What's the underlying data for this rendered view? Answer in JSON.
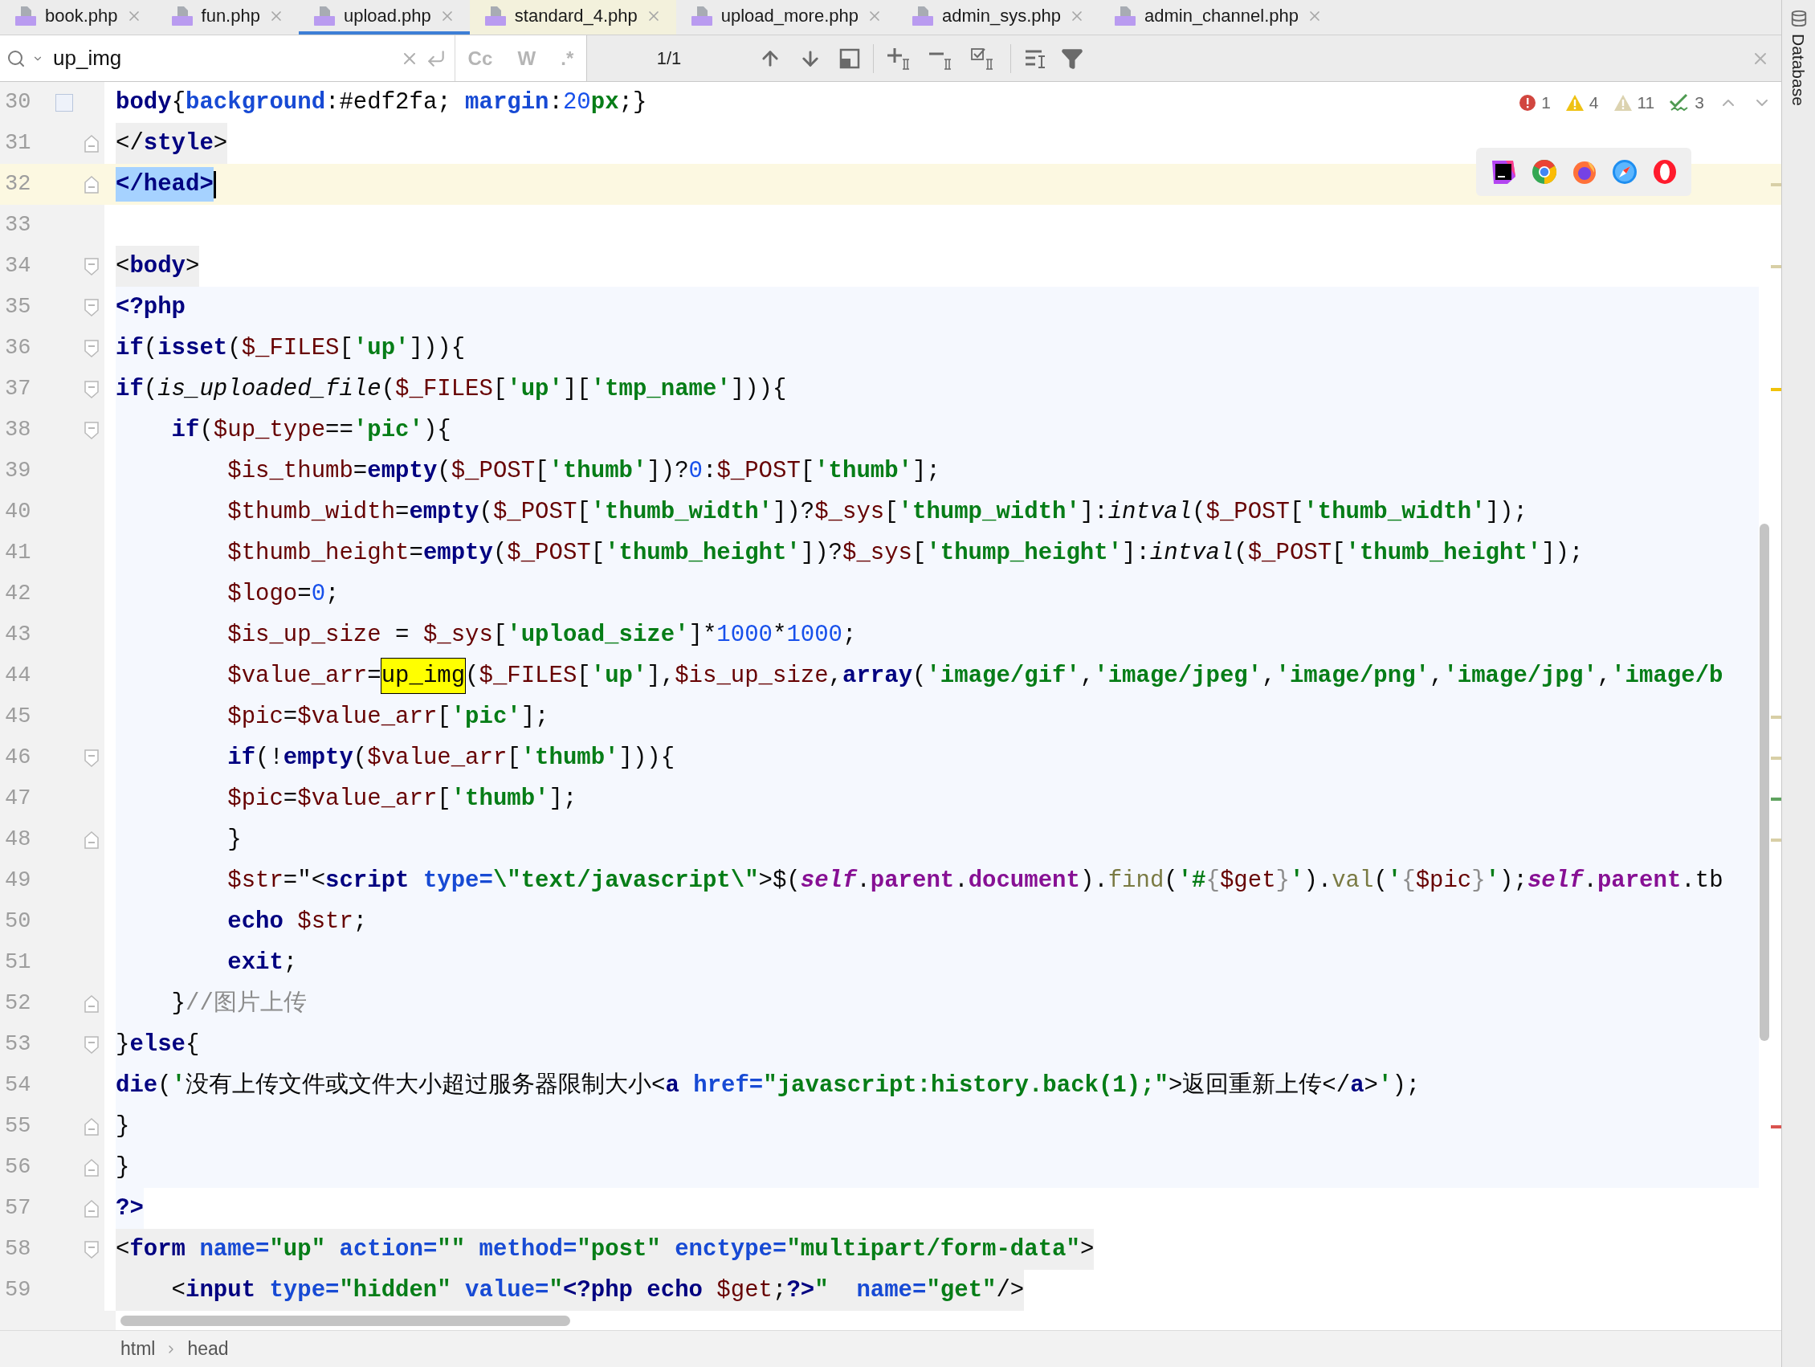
{
  "tabs": [
    {
      "label": "book.php",
      "selected": false,
      "highlighted": false
    },
    {
      "label": "fun.php",
      "selected": false,
      "highlighted": false
    },
    {
      "label": "upload.php",
      "selected": true,
      "highlighted": false
    },
    {
      "label": "standard_4.php",
      "selected": false,
      "highlighted": true
    },
    {
      "label": "upload_more.php",
      "selected": false,
      "highlighted": false
    },
    {
      "label": "admin_sys.php",
      "selected": false,
      "highlighted": false
    },
    {
      "label": "admin_channel.php",
      "selected": false,
      "highlighted": false
    }
  ],
  "search": {
    "value": "up_img",
    "toggles": [
      {
        "label": "Cc",
        "on": false
      },
      {
        "label": "W",
        "on": false
      },
      {
        "label": ".*",
        "on": false
      }
    ],
    "result_count": "1/1"
  },
  "inspections": [
    {
      "kind": "error",
      "count": "1"
    },
    {
      "kind": "warning",
      "count": "4"
    },
    {
      "kind": "weak_warning",
      "count": "11"
    },
    {
      "kind": "typo",
      "count": "3"
    }
  ],
  "lines": [
    {
      "number": "30",
      "current": false,
      "kind": "plain",
      "fold_start": false,
      "fold_end": false,
      "marked": true,
      "tokens": [
        {
          "text": "body",
          "kind": "tag"
        },
        {
          "text": "{",
          "kind": "p"
        },
        {
          "text": "background",
          "kind": "attr"
        },
        {
          "text": ":#edf2fa; ",
          "kind": "p"
        },
        {
          "text": "margin",
          "kind": "attr"
        },
        {
          "text": ":",
          "kind": "p"
        },
        {
          "text": "20",
          "kind": "num"
        },
        {
          "text": "px",
          "kind": "str"
        },
        {
          "text": ";}",
          "kind": "p"
        }
      ]
    },
    {
      "number": "31",
      "current": false,
      "kind": "html-tag",
      "fold_start": false,
      "fold_end": true,
      "marked": false,
      "tokens": [
        {
          "text": "</",
          "kind": "p"
        },
        {
          "text": "style",
          "kind": "tag"
        },
        {
          "text": ">",
          "kind": "p"
        }
      ]
    },
    {
      "number": "32",
      "current": true,
      "kind": "plain",
      "fold_start": false,
      "fold_end": true,
      "marked": false,
      "color": "#d8cfa6",
      "tokens": [
        {
          "text": "</head>",
          "kind": "sel"
        }
      ]
    },
    {
      "number": "33",
      "current": false,
      "kind": "plain",
      "fold_start": false,
      "fold_end": false,
      "marked": false
    },
    {
      "number": "34",
      "current": false,
      "kind": "html-tag",
      "fold_start": true,
      "fold_end": false,
      "marked": false,
      "color": "#d8cfa6",
      "tokens": [
        {
          "text": "<",
          "kind": "p"
        },
        {
          "text": "body",
          "kind": "tag"
        },
        {
          "text": ">",
          "kind": "p"
        }
      ]
    },
    {
      "number": "35",
      "current": false,
      "kind": "php",
      "fold_start": true,
      "fold_end": false,
      "marked": false,
      "tokens": [
        {
          "text": "<?php",
          "kind": "kw"
        }
      ]
    },
    {
      "number": "36",
      "current": false,
      "kind": "php",
      "fold_start": true,
      "fold_end": false,
      "marked": false,
      "tokens": [
        {
          "text": "if",
          "kind": "kw"
        },
        {
          "text": "(",
          "kind": "p"
        },
        {
          "text": "isset",
          "kind": "kw"
        },
        {
          "text": "(",
          "kind": "p"
        },
        {
          "text": "$_FILES",
          "kind": "var"
        },
        {
          "text": "[",
          "kind": "p"
        },
        {
          "text": "'up'",
          "kind": "str"
        },
        {
          "text": "])){",
          "kind": "p"
        }
      ]
    },
    {
      "number": "37",
      "current": false,
      "kind": "php",
      "fold_start": true,
      "fold_end": false,
      "marked": false,
      "color": "#f0c20a",
      "tokens": [
        {
          "text": "if",
          "kind": "kw"
        },
        {
          "text": "(",
          "kind": "p"
        },
        {
          "text": "is_uploaded_file",
          "kind": "it"
        },
        {
          "text": "(",
          "kind": "p"
        },
        {
          "text": "$_FILES",
          "kind": "var"
        },
        {
          "text": "[",
          "kind": "p"
        },
        {
          "text": "'up'",
          "kind": "str"
        },
        {
          "text": "][",
          "kind": "p"
        },
        {
          "text": "'tmp_name'",
          "kind": "str"
        },
        {
          "text": "])){",
          "kind": "p"
        }
      ]
    },
    {
      "number": "38",
      "current": false,
      "kind": "php",
      "fold_start": true,
      "fold_end": false,
      "marked": false,
      "tokens": [
        {
          "text": "    if",
          "kind": "kw"
        },
        {
          "text": "(",
          "kind": "p"
        },
        {
          "text": "$up_type",
          "kind": "var"
        },
        {
          "text": "==",
          "kind": "p"
        },
        {
          "text": "'pic'",
          "kind": "str"
        },
        {
          "text": "){",
          "kind": "p"
        }
      ]
    },
    {
      "number": "39",
      "current": false,
      "kind": "php",
      "fold_start": false,
      "fold_end": false,
      "marked": false,
      "tokens": [
        {
          "text": "        $is_thumb",
          "kind": "var"
        },
        {
          "text": "=",
          "kind": "p"
        },
        {
          "text": "empty",
          "kind": "kw"
        },
        {
          "text": "(",
          "kind": "p"
        },
        {
          "text": "$_POST",
          "kind": "var"
        },
        {
          "text": "[",
          "kind": "p"
        },
        {
          "text": "'thumb'",
          "kind": "str"
        },
        {
          "text": "])?",
          "kind": "p"
        },
        {
          "text": "0",
          "kind": "num"
        },
        {
          "text": ":",
          "kind": "p"
        },
        {
          "text": "$_POST",
          "kind": "var"
        },
        {
          "text": "[",
          "kind": "p"
        },
        {
          "text": "'thumb'",
          "kind": "str"
        },
        {
          "text": "];",
          "kind": "p"
        }
      ]
    },
    {
      "number": "40",
      "current": false,
      "kind": "php",
      "fold_start": false,
      "fold_end": false,
      "marked": false,
      "tokens": [
        {
          "text": "        $thumb_width",
          "kind": "var"
        },
        {
          "text": "=",
          "kind": "p"
        },
        {
          "text": "empty",
          "kind": "kw"
        },
        {
          "text": "(",
          "kind": "p"
        },
        {
          "text": "$_POST",
          "kind": "var"
        },
        {
          "text": "[",
          "kind": "p"
        },
        {
          "text": "'thumb_width'",
          "kind": "str"
        },
        {
          "text": "])?",
          "kind": "p"
        },
        {
          "text": "$_sys",
          "kind": "var"
        },
        {
          "text": "[",
          "kind": "p"
        },
        {
          "text": "'thump_width'",
          "kind": "str"
        },
        {
          "text": "]:",
          "kind": "p"
        },
        {
          "text": "intval",
          "kind": "it"
        },
        {
          "text": "(",
          "kind": "p"
        },
        {
          "text": "$_POST",
          "kind": "var"
        },
        {
          "text": "[",
          "kind": "p"
        },
        {
          "text": "'thumb_width'",
          "kind": "str"
        },
        {
          "text": "]);",
          "kind": "p"
        }
      ]
    },
    {
      "number": "41",
      "current": false,
      "kind": "php",
      "fold_start": false,
      "fold_end": false,
      "marked": false,
      "tokens": [
        {
          "text": "        $thumb_height",
          "kind": "var"
        },
        {
          "text": "=",
          "kind": "p"
        },
        {
          "text": "empty",
          "kind": "kw"
        },
        {
          "text": "(",
          "kind": "p"
        },
        {
          "text": "$_POST",
          "kind": "var"
        },
        {
          "text": "[",
          "kind": "p"
        },
        {
          "text": "'thumb_height'",
          "kind": "str"
        },
        {
          "text": "])?",
          "kind": "p"
        },
        {
          "text": "$_sys",
          "kind": "var"
        },
        {
          "text": "[",
          "kind": "p"
        },
        {
          "text": "'thump_height'",
          "kind": "str"
        },
        {
          "text": "]:",
          "kind": "p"
        },
        {
          "text": "intval",
          "kind": "it"
        },
        {
          "text": "(",
          "kind": "p"
        },
        {
          "text": "$_POST",
          "kind": "var"
        },
        {
          "text": "[",
          "kind": "p"
        },
        {
          "text": "'thumb_height'",
          "kind": "str"
        },
        {
          "text": "]);",
          "kind": "p"
        }
      ]
    },
    {
      "number": "42",
      "current": false,
      "kind": "php",
      "fold_start": false,
      "fold_end": false,
      "marked": false,
      "tokens": [
        {
          "text": "        $logo",
          "kind": "var"
        },
        {
          "text": "=",
          "kind": "p"
        },
        {
          "text": "0",
          "kind": "num"
        },
        {
          "text": ";",
          "kind": "p"
        }
      ]
    },
    {
      "number": "43",
      "current": false,
      "kind": "php",
      "fold_start": false,
      "fold_end": false,
      "marked": false,
      "tokens": [
        {
          "text": "        $is_up_size",
          "kind": "var"
        },
        {
          "text": " = ",
          "kind": "p"
        },
        {
          "text": "$_sys",
          "kind": "var"
        },
        {
          "text": "[",
          "kind": "p"
        },
        {
          "text": "'upload_size'",
          "kind": "str"
        },
        {
          "text": "]*",
          "kind": "p"
        },
        {
          "text": "1000",
          "kind": "num"
        },
        {
          "text": "*",
          "kind": "p"
        },
        {
          "text": "1000",
          "kind": "num"
        },
        {
          "text": ";",
          "kind": "p"
        }
      ]
    },
    {
      "number": "44",
      "current": false,
      "kind": "php",
      "fold_start": false,
      "fold_end": false,
      "marked": false,
      "tokens": [
        {
          "text": "        $value_arr",
          "kind": "var"
        },
        {
          "text": "=",
          "kind": "p"
        },
        {
          "text": "up_img",
          "kind": "match"
        },
        {
          "text": "(",
          "kind": "p"
        },
        {
          "text": "$_FILES",
          "kind": "var"
        },
        {
          "text": "[",
          "kind": "p"
        },
        {
          "text": "'up'",
          "kind": "str"
        },
        {
          "text": "],",
          "kind": "p"
        },
        {
          "text": "$is_up_size",
          "kind": "var"
        },
        {
          "text": ",",
          "kind": "p"
        },
        {
          "text": "array",
          "kind": "kw"
        },
        {
          "text": "(",
          "kind": "p"
        },
        {
          "text": "'image/gif'",
          "kind": "str"
        },
        {
          "text": ",",
          "kind": "p"
        },
        {
          "text": "'image/jpeg'",
          "kind": "str"
        },
        {
          "text": ",",
          "kind": "p"
        },
        {
          "text": "'image/png'",
          "kind": "str"
        },
        {
          "text": ",",
          "kind": "p"
        },
        {
          "text": "'image/jpg'",
          "kind": "str"
        },
        {
          "text": ",",
          "kind": "p"
        },
        {
          "text": "'image/b",
          "kind": "str"
        }
      ]
    },
    {
      "number": "45",
      "current": false,
      "kind": "php",
      "fold_start": false,
      "fold_end": false,
      "marked": false,
      "color": "#d8cfa6",
      "tokens": [
        {
          "text": "        $pic",
          "kind": "var"
        },
        {
          "text": "=",
          "kind": "p"
        },
        {
          "text": "$value_arr",
          "kind": "var"
        },
        {
          "text": "[",
          "kind": "p"
        },
        {
          "text": "'pic'",
          "kind": "str"
        },
        {
          "text": "];",
          "kind": "p"
        }
      ]
    },
    {
      "number": "46",
      "current": false,
      "kind": "php",
      "fold_start": true,
      "fold_end": false,
      "marked": false,
      "color": "#d8cfa6",
      "tokens": [
        {
          "text": "        if",
          "kind": "kw"
        },
        {
          "text": "(!",
          "kind": "p"
        },
        {
          "text": "empty",
          "kind": "kw"
        },
        {
          "text": "(",
          "kind": "p"
        },
        {
          "text": "$value_arr",
          "kind": "var"
        },
        {
          "text": "[",
          "kind": "p"
        },
        {
          "text": "'thumb'",
          "kind": "str"
        },
        {
          "text": "])){",
          "kind": "p"
        }
      ]
    },
    {
      "number": "47",
      "current": false,
      "kind": "php",
      "fold_start": false,
      "fold_end": false,
      "marked": false,
      "color": "#5fa35f",
      "tokens": [
        {
          "text": "        $pic",
          "kind": "var"
        },
        {
          "text": "=",
          "kind": "p"
        },
        {
          "text": "$value_arr",
          "kind": "var"
        },
        {
          "text": "[",
          "kind": "p"
        },
        {
          "text": "'thumb'",
          "kind": "str"
        },
        {
          "text": "];",
          "kind": "p"
        }
      ]
    },
    {
      "number": "48",
      "current": false,
      "kind": "php",
      "fold_start": false,
      "fold_end": true,
      "marked": false,
      "color": "#d8cfa6",
      "tokens": [
        {
          "text": "        }",
          "kind": "p"
        }
      ]
    },
    {
      "number": "49",
      "current": false,
      "kind": "php",
      "fold_start": false,
      "fold_end": false,
      "marked": false,
      "tokens": [
        {
          "text": "        $str",
          "kind": "var"
        },
        {
          "text": "=\"",
          "kind": "p"
        },
        {
          "text": "<",
          "kind": "p"
        },
        {
          "text": "script",
          "kind": "tag"
        },
        {
          "text": " type=",
          "kind": "attr"
        },
        {
          "text": "\\\"text/javascript\\\"",
          "kind": "str"
        },
        {
          "text": ">",
          "kind": "p"
        },
        {
          "text": "$(",
          "kind": "p"
        },
        {
          "text": "self",
          "kind": "js"
        },
        {
          "text": ".",
          "kind": "p"
        },
        {
          "text": "parent",
          "kind": "jo"
        },
        {
          "text": ".",
          "kind": "p"
        },
        {
          "text": "document",
          "kind": "jo"
        },
        {
          "text": ").",
          "kind": "p"
        },
        {
          "text": "find",
          "kind": "jf"
        },
        {
          "text": "(",
          "kind": "p"
        },
        {
          "text": "'#",
          "kind": "str"
        },
        {
          "text": "{",
          "kind": "br"
        },
        {
          "text": "$get",
          "kind": "var"
        },
        {
          "text": "}",
          "kind": "br"
        },
        {
          "text": "'",
          "kind": "str"
        },
        {
          "text": ").",
          "kind": "p"
        },
        {
          "text": "val",
          "kind": "jf"
        },
        {
          "text": "(",
          "kind": "p"
        },
        {
          "text": "'",
          "kind": "str"
        },
        {
          "text": "{",
          "kind": "br"
        },
        {
          "text": "$pic",
          "kind": "var"
        },
        {
          "text": "}",
          "kind": "br"
        },
        {
          "text": "'",
          "kind": "str"
        },
        {
          "text": ");",
          "kind": "p"
        },
        {
          "text": "self",
          "kind": "js"
        },
        {
          "text": ".",
          "kind": "p"
        },
        {
          "text": "parent",
          "kind": "jo"
        },
        {
          "text": ".",
          "kind": "p"
        },
        {
          "text": "tb",
          "kind": "p"
        }
      ]
    },
    {
      "number": "50",
      "current": false,
      "kind": "php",
      "fold_start": false,
      "fold_end": false,
      "marked": false,
      "tokens": [
        {
          "text": "        echo",
          "kind": "kw"
        },
        {
          "text": " $str",
          "kind": "var"
        },
        {
          "text": ";",
          "kind": "p"
        }
      ]
    },
    {
      "number": "51",
      "current": false,
      "kind": "php",
      "fold_start": false,
      "fold_end": false,
      "marked": false,
      "tokens": [
        {
          "text": "        exit",
          "kind": "kw"
        },
        {
          "text": ";",
          "kind": "p"
        }
      ]
    },
    {
      "number": "52",
      "current": false,
      "kind": "php",
      "fold_start": false,
      "fold_end": true,
      "marked": false,
      "tokens": [
        {
          "text": "    }",
          "kind": "p"
        },
        {
          "text": "//图片上传",
          "kind": "cm"
        }
      ]
    },
    {
      "number": "53",
      "current": false,
      "kind": "php",
      "fold_start": true,
      "fold_end": false,
      "marked": false,
      "tokens": [
        {
          "text": "}",
          "kind": "p"
        },
        {
          "text": "else",
          "kind": "kw"
        },
        {
          "text": "{",
          "kind": "p"
        }
      ]
    },
    {
      "number": "54",
      "current": false,
      "kind": "php",
      "fold_start": false,
      "fold_end": false,
      "marked": false,
      "tokens": [
        {
          "text": "die",
          "kind": "kw"
        },
        {
          "text": "(",
          "kind": "p"
        },
        {
          "text": "'",
          "kind": "str"
        },
        {
          "text": "没有上传文件或文件大小超过服务器限制大小",
          "kind": "p"
        },
        {
          "text": "<",
          "kind": "p"
        },
        {
          "text": "a",
          "kind": "tag"
        },
        {
          "text": " href=",
          "kind": "attr"
        },
        {
          "text": "\"javascript:history.back(1);\"",
          "kind": "str"
        },
        {
          "text": ">",
          "kind": "p"
        },
        {
          "text": "返回重新上传",
          "kind": "p"
        },
        {
          "text": "</",
          "kind": "p"
        },
        {
          "text": "a",
          "kind": "tag"
        },
        {
          "text": ">",
          "kind": "p"
        },
        {
          "text": "'",
          "kind": "str"
        },
        {
          "text": ");",
          "kind": "p"
        }
      ]
    },
    {
      "number": "55",
      "current": false,
      "kind": "php",
      "fold_start": false,
      "fold_end": true,
      "marked": false,
      "color": "#d9534f",
      "tokens": [
        {
          "text": "}",
          "kind": "p"
        }
      ]
    },
    {
      "number": "56",
      "current": false,
      "kind": "php",
      "fold_start": false,
      "fold_end": true,
      "marked": false,
      "tokens": [
        {
          "text": "}",
          "kind": "p"
        }
      ]
    },
    {
      "number": "57",
      "current": false,
      "kind": "php-end",
      "fold_start": false,
      "fold_end": true,
      "marked": false,
      "tokens": [
        {
          "text": "?>",
          "kind": "kw"
        }
      ]
    },
    {
      "number": "58",
      "current": false,
      "kind": "html-tag",
      "fold_start": true,
      "fold_end": false,
      "marked": false,
      "tokens": [
        {
          "text": "<",
          "kind": "p"
        },
        {
          "text": "form",
          "kind": "tag"
        },
        {
          "text": " name=",
          "kind": "attr"
        },
        {
          "text": "\"up\"",
          "kind": "str"
        },
        {
          "text": " action=",
          "kind": "attr"
        },
        {
          "text": "\"\"",
          "kind": "str"
        },
        {
          "text": " method=",
          "kind": "attr"
        },
        {
          "text": "\"post\"",
          "kind": "str"
        },
        {
          "text": " enctype=",
          "kind": "attr"
        },
        {
          "text": "\"multipart/form-data\"",
          "kind": "str"
        },
        {
          "text": ">",
          "kind": "p"
        }
      ]
    },
    {
      "number": "59",
      "current": false,
      "kind": "html-tag",
      "fold_start": false,
      "fold_end": false,
      "marked": false,
      "tokens": [
        {
          "text": "    <",
          "kind": "p"
        },
        {
          "text": "input",
          "kind": "tag"
        },
        {
          "text": " type=",
          "kind": "attr"
        },
        {
          "text": "\"hidden\"",
          "kind": "str"
        },
        {
          "text": " value=",
          "kind": "attr"
        },
        {
          "text": "\"",
          "kind": "str"
        },
        {
          "text": "<?php",
          "kind": "kw"
        },
        {
          "text": " echo",
          "kind": "kw"
        },
        {
          "text": " $get",
          "kind": "var"
        },
        {
          "text": ";",
          "kind": "p"
        },
        {
          "text": "?>",
          "kind": "kw"
        },
        {
          "text": "\"",
          "kind": "str"
        },
        {
          "text": "  name=",
          "kind": "attr"
        },
        {
          "text": "\"get\"",
          "kind": "str"
        },
        {
          "text": "/>",
          "kind": "p"
        }
      ]
    }
  ],
  "breadcrumbs": [
    "html",
    "head"
  ],
  "side_panel": {
    "label": "Database"
  }
}
